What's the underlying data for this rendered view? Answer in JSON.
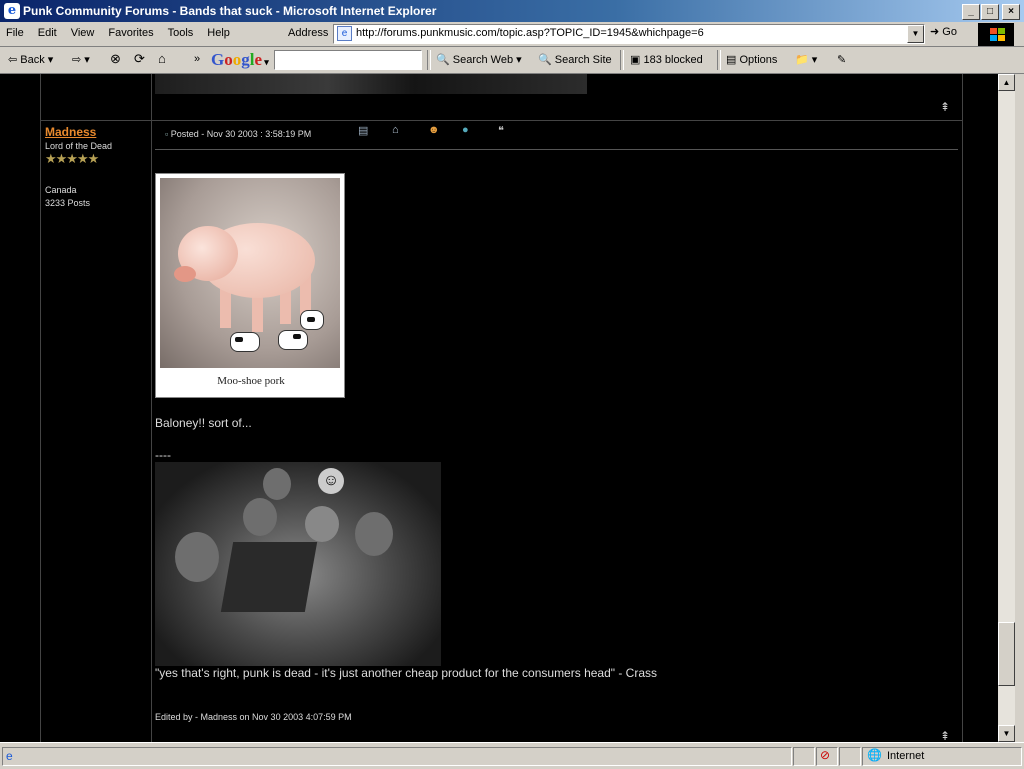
{
  "window": {
    "title": "Punk Community Forums - Bands that suck - Microsoft Internet Explorer",
    "minimize": "_",
    "maximize": "□",
    "close": "×"
  },
  "menu": [
    "File",
    "Edit",
    "View",
    "Favorites",
    "Tools",
    "Help"
  ],
  "address": {
    "label": "Address",
    "url": "http://forums.punkmusic.com/topic.asp?TOPIC_ID=1945&whichpage=6",
    "go_label": "Go"
  },
  "toolbar": {
    "back_label": "Back",
    "google_label": [
      "G",
      "o",
      "o",
      "g",
      "l",
      "e"
    ],
    "search_value": "",
    "search_web_label": "Search Web",
    "search_site_label": "Search Site",
    "blocked_label": "183 blocked",
    "options_label": "Options"
  },
  "post": {
    "author": "Madness",
    "author_title": "Lord of the Dead",
    "stars": "★★★★★",
    "location": "Canada",
    "post_count": "3233 Posts",
    "posted": "Posted - Nov 30 2003 :  3:58:19 PM",
    "image_caption": "Moo-shoe pork",
    "body": "Baloney!! sort of...",
    "sig_separator": "----",
    "sig_quote": "\"yes that's right, punk is dead - it's just another cheap product for the consumers head\" - Crass",
    "edited": "Edited by - Madness on Nov 30 2003 4:07:59 PM"
  },
  "status": {
    "zone": "Internet"
  },
  "colors": {
    "username": "#e8892d",
    "page_background": "#000000",
    "text": "#dddddd"
  }
}
